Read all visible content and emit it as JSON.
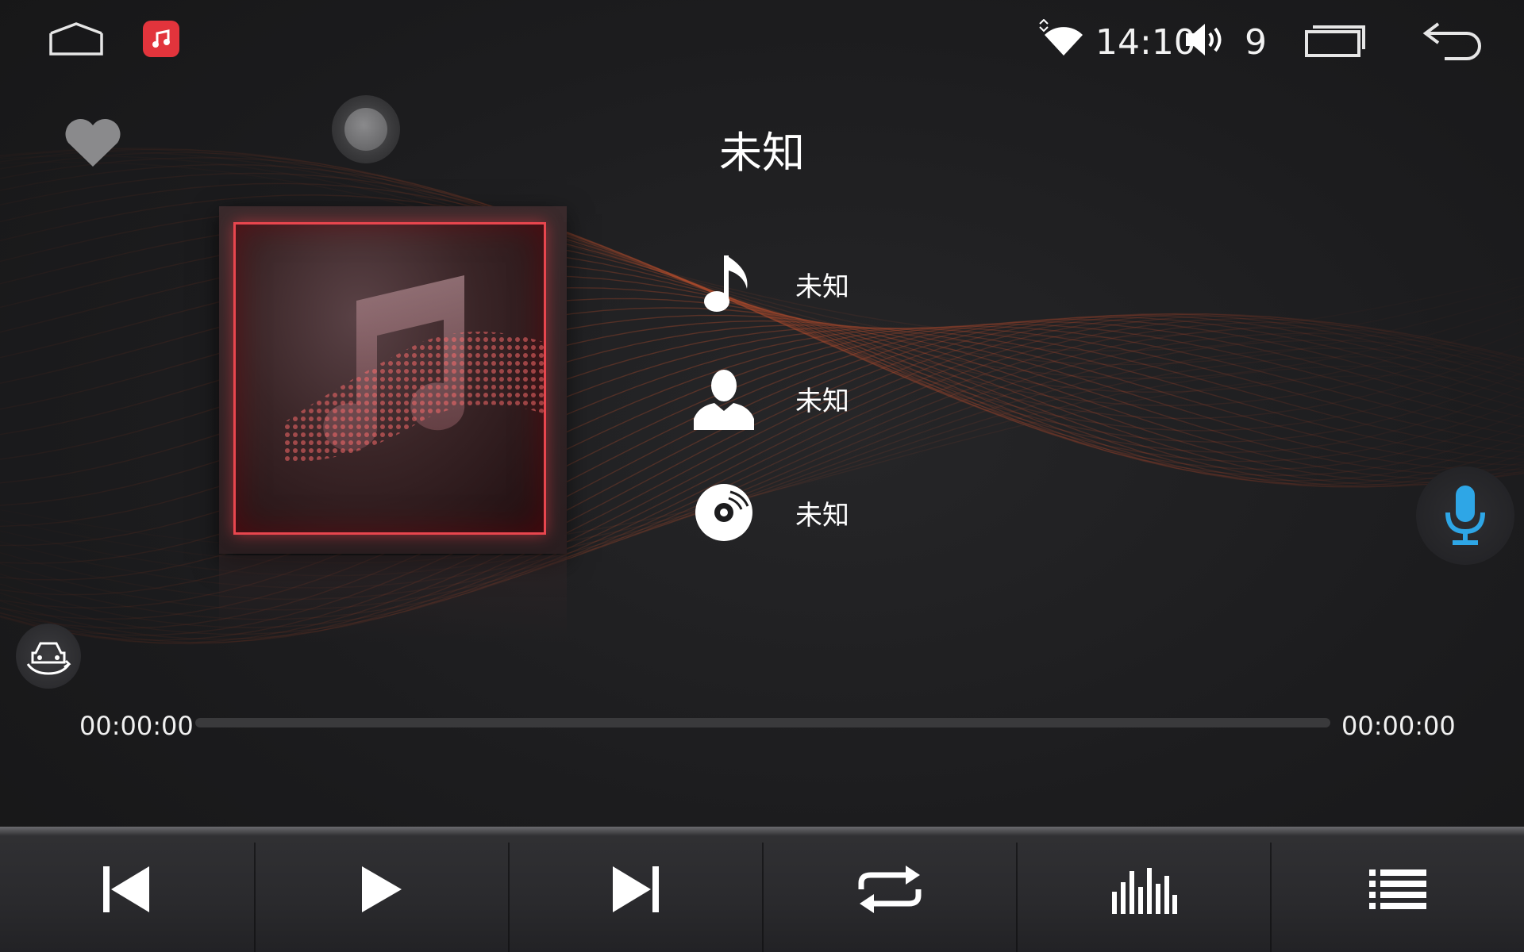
{
  "status_bar": {
    "time": "14:10",
    "volume": "9",
    "icons": [
      "home-icon",
      "music-app-icon",
      "wifi-icon",
      "volume-icon",
      "recent-apps-icon",
      "back-icon"
    ]
  },
  "player": {
    "title": "未知",
    "song": "未知",
    "artist": "未知",
    "album": "未知",
    "elapsed": "00:00:00",
    "duration": "00:00:00",
    "progress_fraction": 0
  },
  "controls": {
    "icons": [
      "previous-icon",
      "play-icon",
      "next-icon",
      "repeat-icon",
      "equalizer-icon",
      "playlist-icon"
    ]
  },
  "colors": {
    "accent_red": "#e8464e",
    "wave_orange": "#b8472a",
    "mic_blue": "#2ea6e6",
    "music_app_red": "#e2343c"
  }
}
